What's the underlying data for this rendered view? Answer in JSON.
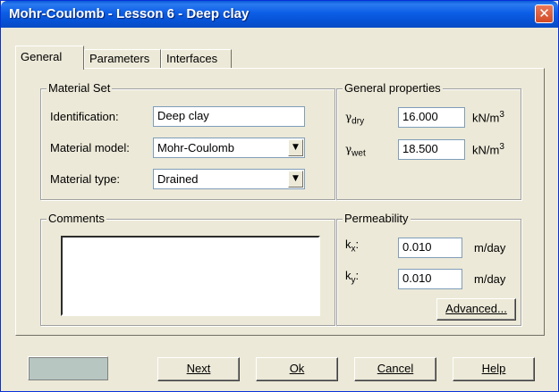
{
  "window": {
    "title": "Mohr-Coulomb - Lesson 6 - Deep clay",
    "close_glyph": "✕"
  },
  "tabs": [
    {
      "label": "General",
      "active": true
    },
    {
      "label": "Parameters",
      "active": false
    },
    {
      "label": "Interfaces",
      "active": false
    }
  ],
  "material_set": {
    "group_label": "Material Set",
    "identification_label": "Identification:",
    "identification_value": "Deep clay",
    "model_label": "Material model:",
    "model_value": "Mohr-Coulomb",
    "type_label": "Material type:",
    "type_value": "Drained"
  },
  "comments": {
    "group_label": "Comments",
    "value": ""
  },
  "general_properties": {
    "group_label": "General properties",
    "gamma_dry": {
      "symbol": "γ",
      "subscript": "dry",
      "value": "16.000",
      "unit": "kN/m",
      "unit_sup": "3"
    },
    "gamma_wet": {
      "symbol": "γ",
      "subscript": "wet",
      "value": "18.500",
      "unit": "kN/m",
      "unit_sup": "3"
    }
  },
  "permeability": {
    "group_label": "Permeability",
    "kx": {
      "symbol": "k",
      "subscript": "x",
      "colon": ":",
      "value": "0.010",
      "unit": "m/day"
    },
    "ky": {
      "symbol": "k",
      "subscript": "y",
      "colon": ":",
      "value": "0.010",
      "unit": "m/day"
    },
    "advanced_label": "Advanced..."
  },
  "footer": {
    "next_label": "Next",
    "ok_label": "Ok",
    "cancel_label": "Cancel",
    "help_label": "Help",
    "status_color": "#b7c6c1"
  },
  "icons": {
    "dropdown": "chevron-down-icon",
    "close": "close-icon"
  }
}
